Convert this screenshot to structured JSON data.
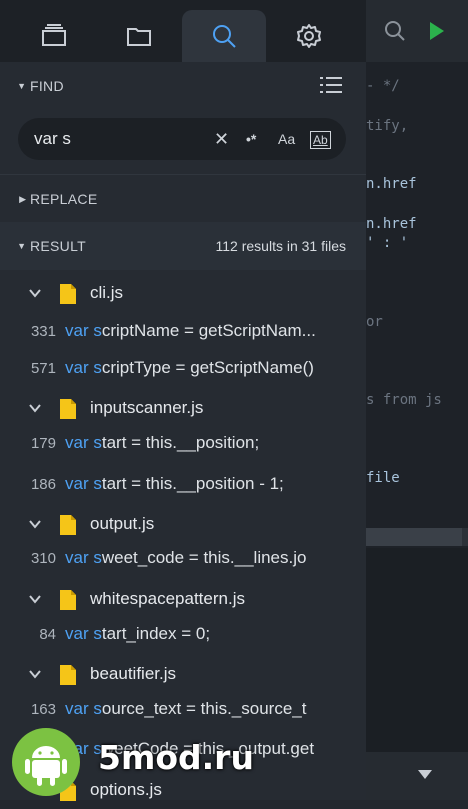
{
  "tabs": [
    {
      "name": "tabs-icon"
    },
    {
      "name": "folder-icon"
    },
    {
      "name": "search-icon",
      "active": true
    },
    {
      "name": "gear-icon"
    }
  ],
  "find": {
    "label": "FIND",
    "query": "var s",
    "options": {
      "clear": "✕",
      "regex": "•*",
      "match_case": "Aa",
      "whole_word": "Ab"
    }
  },
  "replace": {
    "label": "REPLACE"
  },
  "result": {
    "label": "RESULT",
    "summary": "112 results in 31 files"
  },
  "files": [
    {
      "name": "cli.js",
      "matches": [
        {
          "line": "331",
          "pre": "var",
          "hl": "s",
          "rest": "criptName = getScriptNam..."
        },
        {
          "line": "571",
          "pre": "var",
          "hl": "s",
          "rest": "criptType = getScriptName()"
        }
      ]
    },
    {
      "name": "inputscanner.js",
      "matches": [
        {
          "line": "179",
          "pre": "var",
          "hl": "s",
          "rest": "tart = this.__position;"
        },
        {
          "line": "186",
          "pre": "var",
          "hl": "s",
          "rest": "tart = this.__position - 1;"
        }
      ]
    },
    {
      "name": "output.js",
      "matches": [
        {
          "line": "310",
          "pre": "var",
          "hl": "s",
          "rest": "weet_code = this.__lines.jo"
        }
      ]
    },
    {
      "name": "whitespacepattern.js",
      "matches": [
        {
          "line": "84",
          "pre": "var",
          "hl": "s",
          "rest": "tart_index = 0;"
        }
      ]
    },
    {
      "name": "beautifier.js",
      "matches": [
        {
          "line": "163",
          "pre": "var",
          "hl": "s",
          "rest": "ource_text = this._source_t"
        },
        {
          "line": "",
          "pre": "var",
          "hl": "s",
          "rest": "weetCode = this._output.get"
        }
      ]
    },
    {
      "name": "options.js",
      "matches": []
    }
  ],
  "editor": {
    "lines": [
      {
        "text": "- */",
        "kind": "comment"
      },
      {
        "text": "tify,",
        "kind": "comment"
      },
      {
        "text": "n.href",
        "kind": "code"
      },
      {
        "text": "n.href",
        "kind": "code"
      },
      {
        "text": "' : '",
        "kind": "code"
      },
      {
        "text": "or",
        "kind": "comment"
      },
      {
        "text": "s from js",
        "kind": "comment"
      },
      {
        "text": "file",
        "kind": "code"
      }
    ]
  },
  "watermark": {
    "text": "5mod.ru"
  },
  "colors": {
    "accent": "#4ea1f3",
    "file_icon": "#f5c518",
    "panel": "#262b32"
  }
}
